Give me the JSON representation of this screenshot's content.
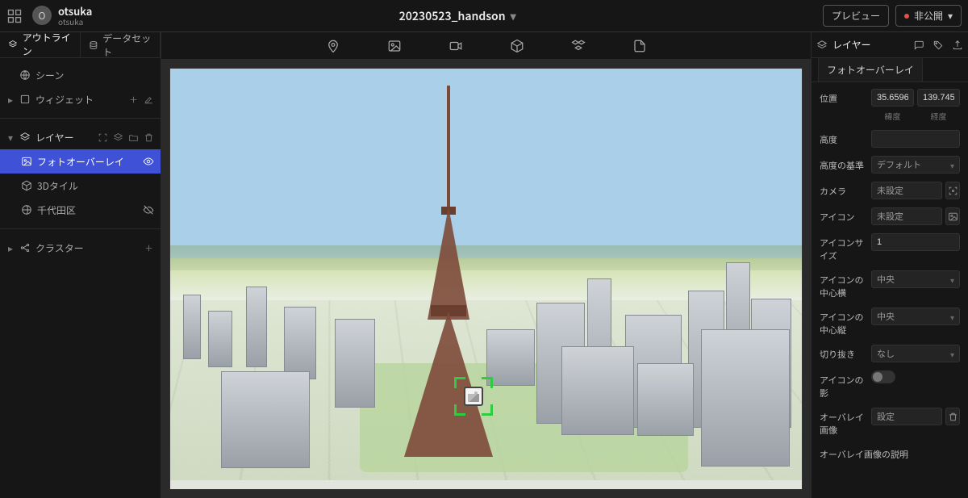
{
  "header": {
    "workspace_name": "otsuka",
    "workspace_subtitle": "otsuka",
    "avatar_initial": "O",
    "project_title": "20230523_handson",
    "preview_label": "プレビュー",
    "publish_status_label": "非公開"
  },
  "left_panel": {
    "tabs": {
      "outline": "アウトライン",
      "dataset": "データセット"
    },
    "scene_label": "シーン",
    "widget_label": "ウィジェット",
    "layers_section_label": "レイヤー",
    "layers": [
      {
        "id": "photo_overlay",
        "label": "フォトオーバーレイ",
        "visible": true,
        "selected": true,
        "icon": "image"
      },
      {
        "id": "3d_tiles",
        "label": "3Dタイル",
        "visible": true,
        "selected": false,
        "icon": "cube"
      },
      {
        "id": "chiyoda",
        "label": "千代田区",
        "visible": false,
        "selected": false,
        "icon": "globe"
      }
    ],
    "cluster_label": "クラスター"
  },
  "center_tools": [
    "pin",
    "image",
    "video",
    "cube",
    "cubes",
    "file"
  ],
  "right_panel": {
    "tab_label": "レイヤー",
    "subtab_label": "フォトオーバーレイ",
    "props": {
      "position_label": "位置",
      "lat_value": "35.6596",
      "lat_label": "緯度",
      "lng_value": "139.745",
      "lng_label": "経度",
      "altitude_label": "高度",
      "altitude_value": "",
      "altitude_base_label": "高度の基準",
      "altitude_base_value": "デフォルト",
      "camera_label": "カメラ",
      "camera_value": "未設定",
      "icon_label": "アイコン",
      "icon_value": "未設定",
      "icon_size_label": "アイコンサイズ",
      "icon_size_value": "1",
      "icon_center_h_label": "アイコンの中心横",
      "icon_center_h_value": "中央",
      "icon_center_v_label": "アイコンの中心縦",
      "icon_center_v_value": "中央",
      "crop_label": "切り抜き",
      "crop_value": "なし",
      "icon_shadow_label": "アイコンの影",
      "overlay_image_label": "オーバレイ画像",
      "overlay_image_value": "設定",
      "overlay_desc_label": "オーバレイ画像の説明"
    }
  }
}
